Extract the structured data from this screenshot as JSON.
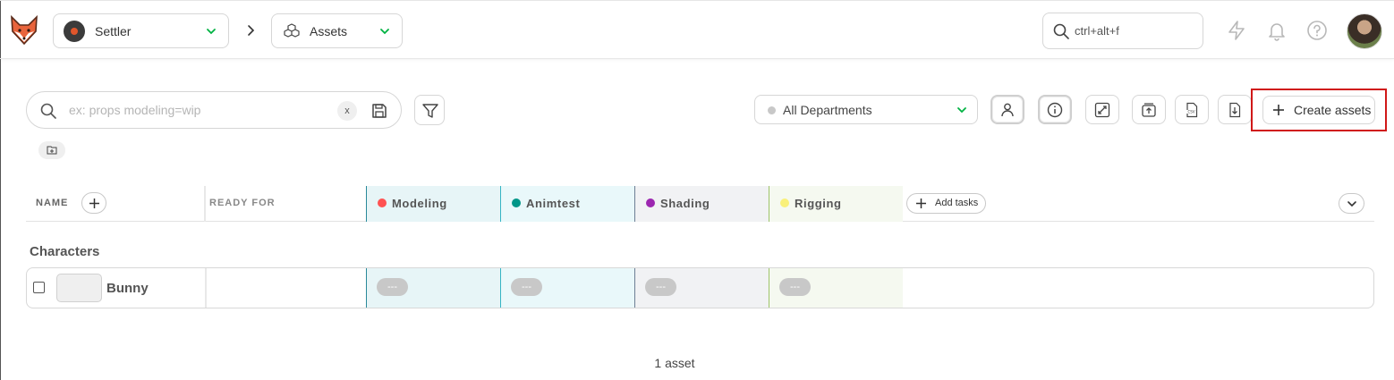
{
  "header": {
    "production": {
      "name": "Settler",
      "icon": "production-thumbnail"
    },
    "section": {
      "label": "Assets",
      "icon": "cubes-icon"
    },
    "global_search": {
      "text": "ctrl+alt+f"
    },
    "icons": [
      "lightning-icon",
      "bell-icon",
      "help-icon"
    ],
    "accent": "#00b242"
  },
  "filters": {
    "search": {
      "placeholder": "ex: props modeling=wip",
      "value": "",
      "clear_label": "x"
    },
    "department": {
      "label": "All Departments",
      "dot_color": "#c8c8c8"
    },
    "create_button": {
      "label": "Create assets"
    },
    "highlight_color": "#d01818"
  },
  "table": {
    "headers": {
      "name": "NAME",
      "ready_for": "READY FOR",
      "add_tasks": "Add tasks"
    },
    "task_types": [
      {
        "name": "Modeling",
        "color": "#ff5252",
        "bg": "#e7f5f7",
        "border": "#2a8a9a"
      },
      {
        "name": "Animtest",
        "color": "#009688",
        "bg": "#e9f8fa",
        "border": "#34b4c4"
      },
      {
        "name": "Shading",
        "color": "#9c27b0",
        "bg": "#f1f2f4",
        "border": "#6e7f95"
      },
      {
        "name": "Rigging",
        "color": "#f9f07a",
        "bg": "#f5f9f0",
        "border": "#9ec46a"
      }
    ],
    "groups": [
      {
        "title": "Characters",
        "rows": [
          {
            "name": "Bunny",
            "statuses": [
              "---",
              "---",
              "---",
              "---"
            ]
          }
        ]
      }
    ]
  },
  "footer": {
    "count_text": "1 asset"
  }
}
